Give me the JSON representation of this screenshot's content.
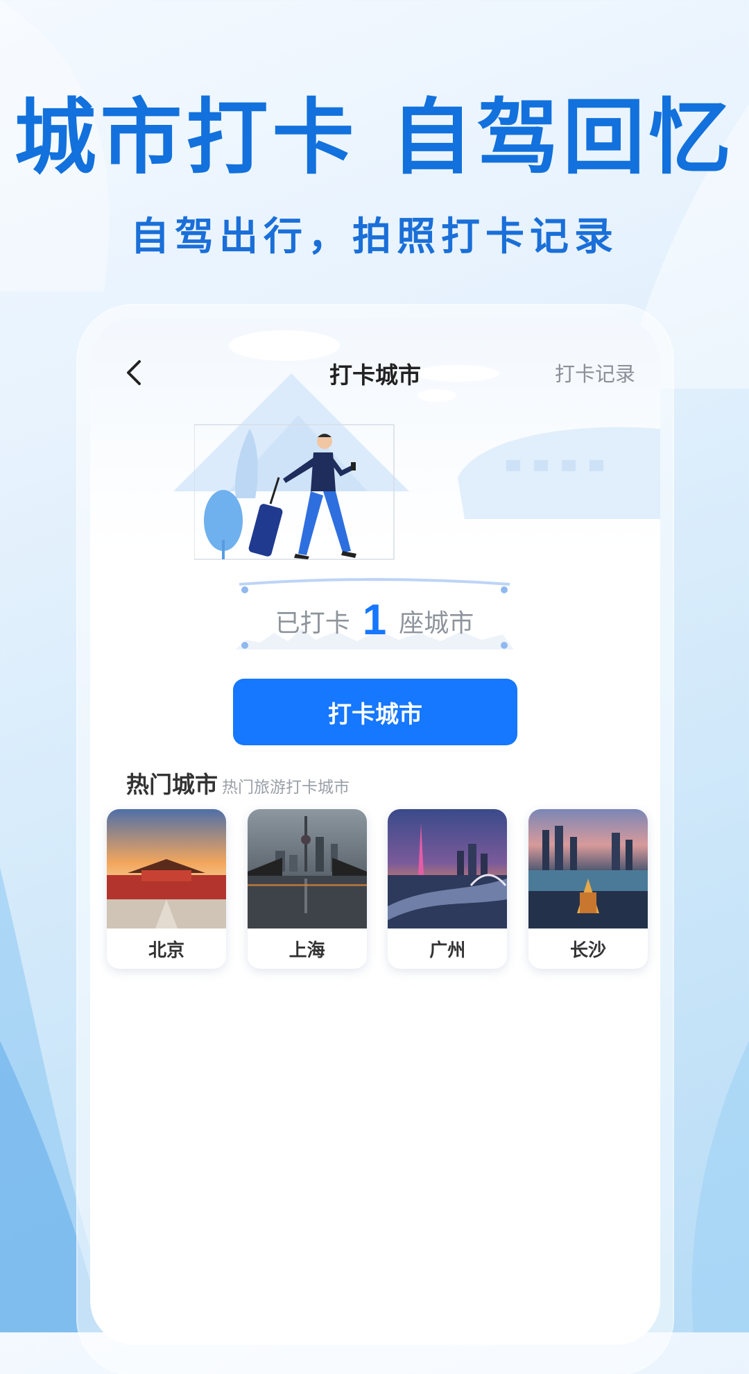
{
  "promo": {
    "title": "城市打卡 自驾回忆",
    "subtitle": "自驾出行，拍照打卡记录"
  },
  "nav": {
    "back_icon": "chevron-left-icon",
    "title": "打卡城市",
    "action": "打卡记录"
  },
  "counter": {
    "prefix": "已打卡",
    "count": "1",
    "suffix": "座城市"
  },
  "checkin_button": "打卡城市",
  "hot": {
    "title": "热门城市",
    "subtitle": "热门旅游打卡城市",
    "cities": [
      {
        "name": "北京"
      },
      {
        "name": "上海"
      },
      {
        "name": "广州"
      },
      {
        "name": "长沙"
      }
    ]
  },
  "colors": {
    "accent": "#1677ff",
    "promo_text": "#1271dc"
  }
}
